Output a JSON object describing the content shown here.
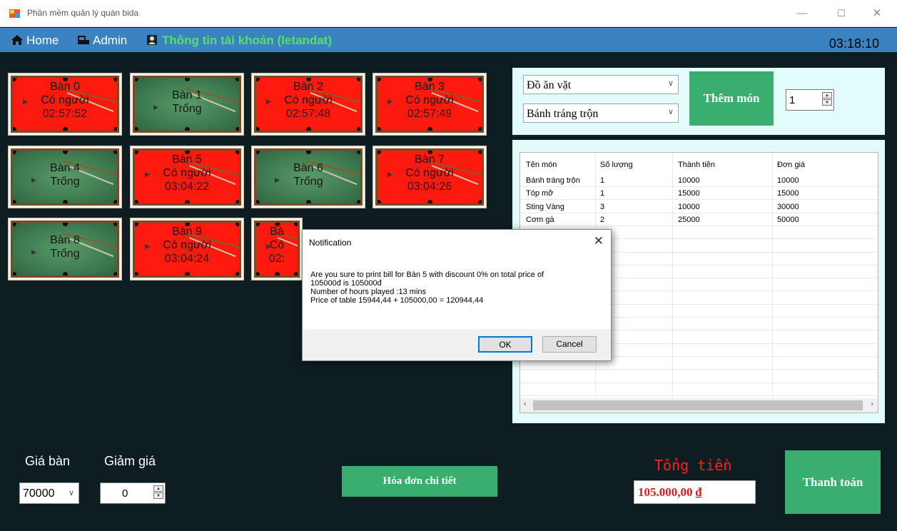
{
  "window": {
    "title": "Phần mềm quản lý quán bida",
    "minimize": "—",
    "maximize": "☐",
    "close": "✕"
  },
  "menu": {
    "home": "Home",
    "admin": "Admin",
    "account": "Thông tin tài khoản (letandat)",
    "clock": "03:18:10"
  },
  "tables": [
    {
      "name": "Bàn 0",
      "status": "Có người",
      "time": "02:57:52",
      "busy": true
    },
    {
      "name": "Bàn 1",
      "status": "Trống",
      "time": "",
      "busy": false
    },
    {
      "name": "Bàn 2",
      "status": "Có người",
      "time": "02:57:48",
      "busy": true
    },
    {
      "name": "Bàn 3",
      "status": "Có người",
      "time": "02:57:49",
      "busy": true
    },
    {
      "name": "Bàn 4",
      "status": "Trống",
      "time": "",
      "busy": false
    },
    {
      "name": "Bàn 5",
      "status": "Có người",
      "time": "03:04:22",
      "busy": true
    },
    {
      "name": "Bàn 6",
      "status": "Trống",
      "time": "",
      "busy": false
    },
    {
      "name": "Bàn 7",
      "status": "Có người",
      "time": "03:04:26",
      "busy": true
    },
    {
      "name": "Bàn 8",
      "status": "Trống",
      "time": "",
      "busy": false
    },
    {
      "name": "Bàn 9",
      "status": "Có người",
      "time": "03:04:24",
      "busy": true
    },
    {
      "name": "Bà",
      "status": "Có",
      "time": "02:",
      "busy": true
    }
  ],
  "order": {
    "category": "Đồ ăn vặt",
    "food": "Bánh tráng trộn",
    "add_label": "Thêm món",
    "quantity": "1"
  },
  "bill": {
    "columns": [
      "Tên món",
      "Số lượng",
      "Thành tiền",
      "Đơn giá"
    ],
    "rows": [
      [
        "Bánh tráng trộn",
        "1",
        "10000",
        "10000"
      ],
      [
        "Tóp mỡ",
        "1",
        "15000",
        "15000"
      ],
      [
        "Sting Vàng",
        "3",
        "10000",
        "30000"
      ],
      [
        "Cơm gà",
        "2",
        "25000",
        "50000"
      ]
    ]
  },
  "bottom": {
    "price_label": "Giá bàn",
    "price_value": "70000",
    "discount_label": "Giảm giá",
    "discount_value": "0",
    "detail_button": "Hóa đơn chi tiết",
    "total_label": "Tổng tiền",
    "total_value": "105.000,00 ₫",
    "pay_button": "Thanh toán"
  },
  "dialog": {
    "title": "Notification",
    "message_line1": "Are you sure to print bill for Bàn 5 with discount 0% on total price of",
    "message_line2": "105000đ is 105000đ",
    "message_line3": "Number of hours played :13 mins",
    "message_line4": "Price of table 15944,44 + 105000,00 = 120944,44",
    "ok": "OK",
    "cancel": "Cancel"
  },
  "colors": {
    "busy": "#ff1a10",
    "free": "#3d7a4f",
    "accent": "#3aae6e",
    "menu": "#3a82c0",
    "total": "#ff2222"
  }
}
